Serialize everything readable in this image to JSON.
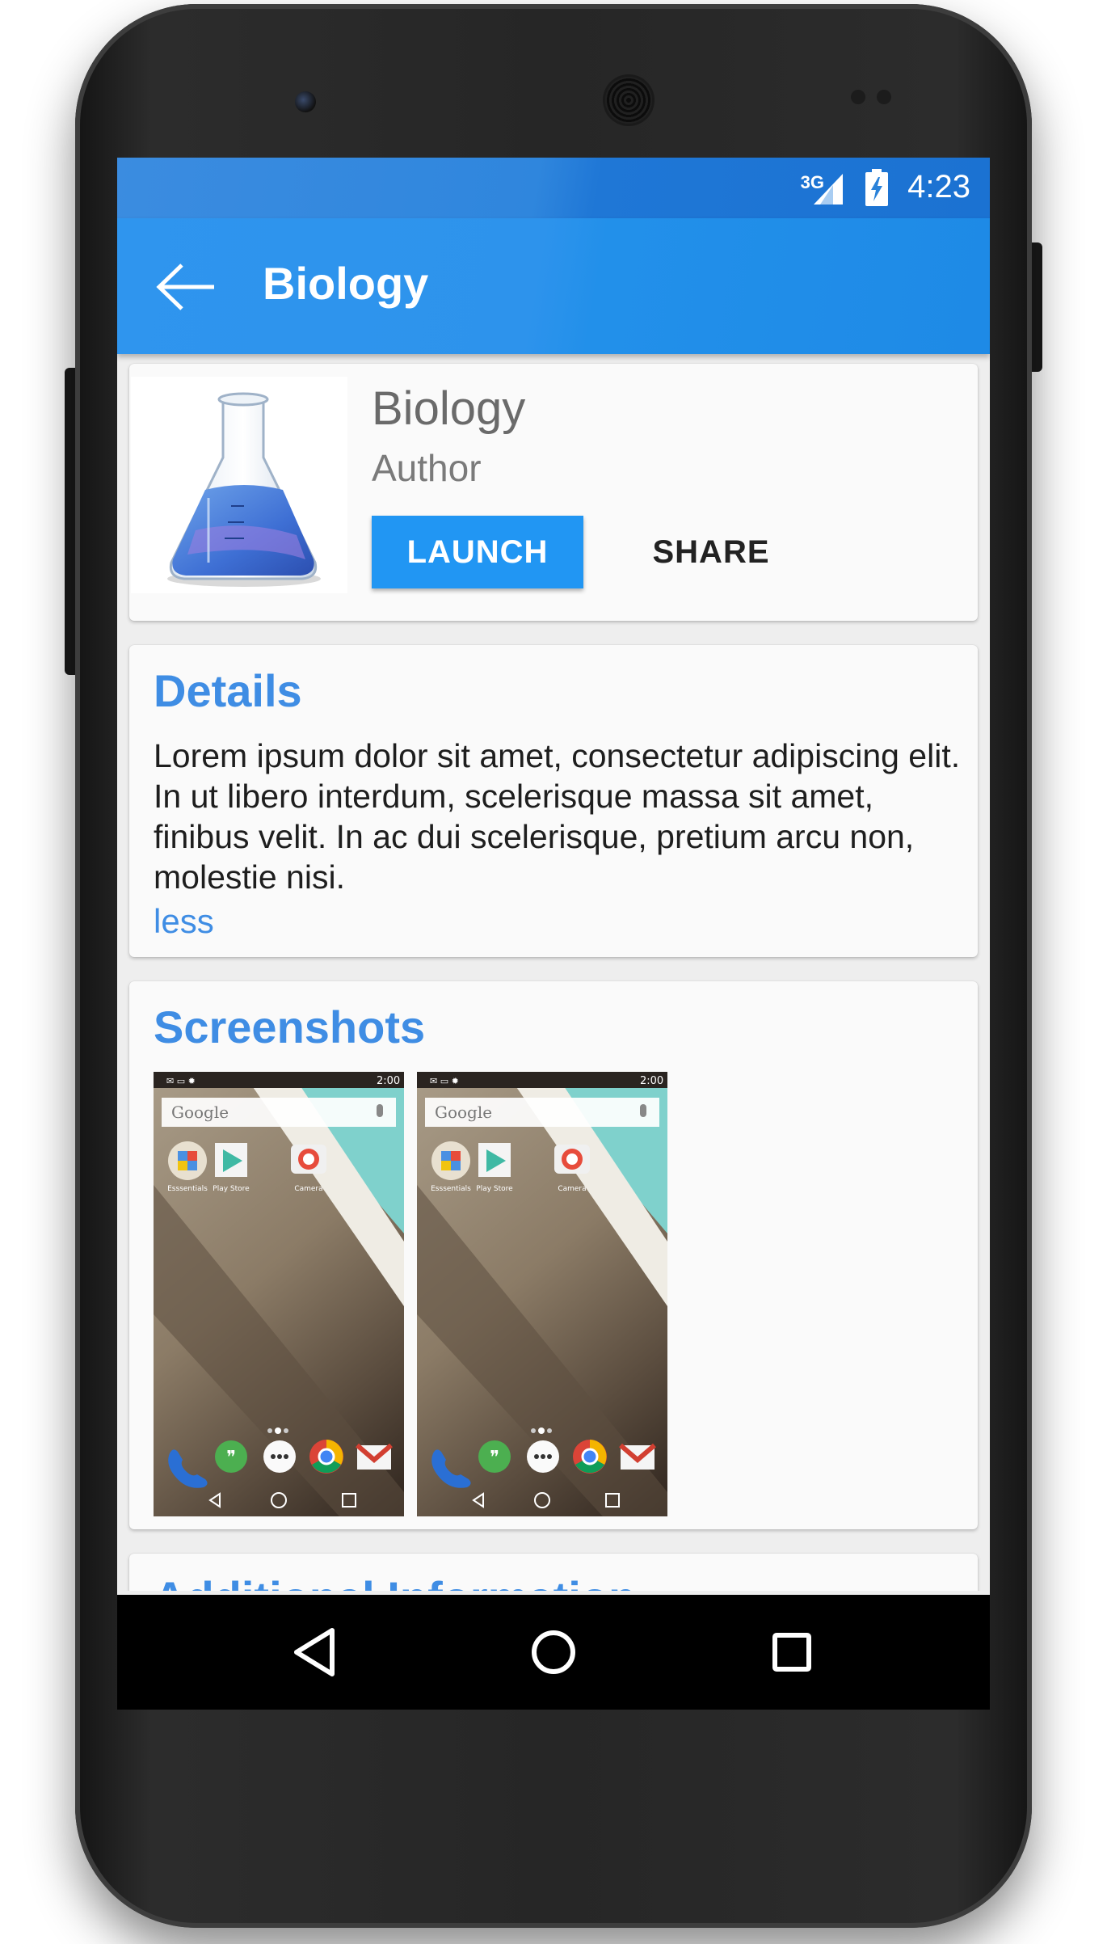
{
  "status_bar": {
    "network": "3G",
    "time": "4:23"
  },
  "toolbar": {
    "title": "Biology"
  },
  "app": {
    "name": "Biology",
    "author": "Author",
    "launch_label": "LAUNCH",
    "share_label": "SHARE"
  },
  "details": {
    "title": "Details",
    "text": "Lorem ipsum dolor sit amet, consectetur adipiscing elit. In ut libero interdum, scelerisque massa sit amet, finibus velit. In ac dui scelerisque, pretium arcu non, molestie nisi.",
    "toggle_label": "less"
  },
  "screenshots": {
    "title": "Screenshots",
    "items": [
      {
        "status_time": "2:00",
        "search_label": "Google",
        "apps": [
          "Esssentials",
          "Play Store",
          "Camera"
        ]
      },
      {
        "status_time": "2:00",
        "search_label": "Google",
        "apps": [
          "Esssentials",
          "Play Store",
          "Camera"
        ]
      }
    ]
  },
  "additional": {
    "title": "Additional Information"
  },
  "colors": {
    "accent": "#2196f3",
    "section_title": "#3f8de4",
    "toolbar": "#2d93ec"
  }
}
